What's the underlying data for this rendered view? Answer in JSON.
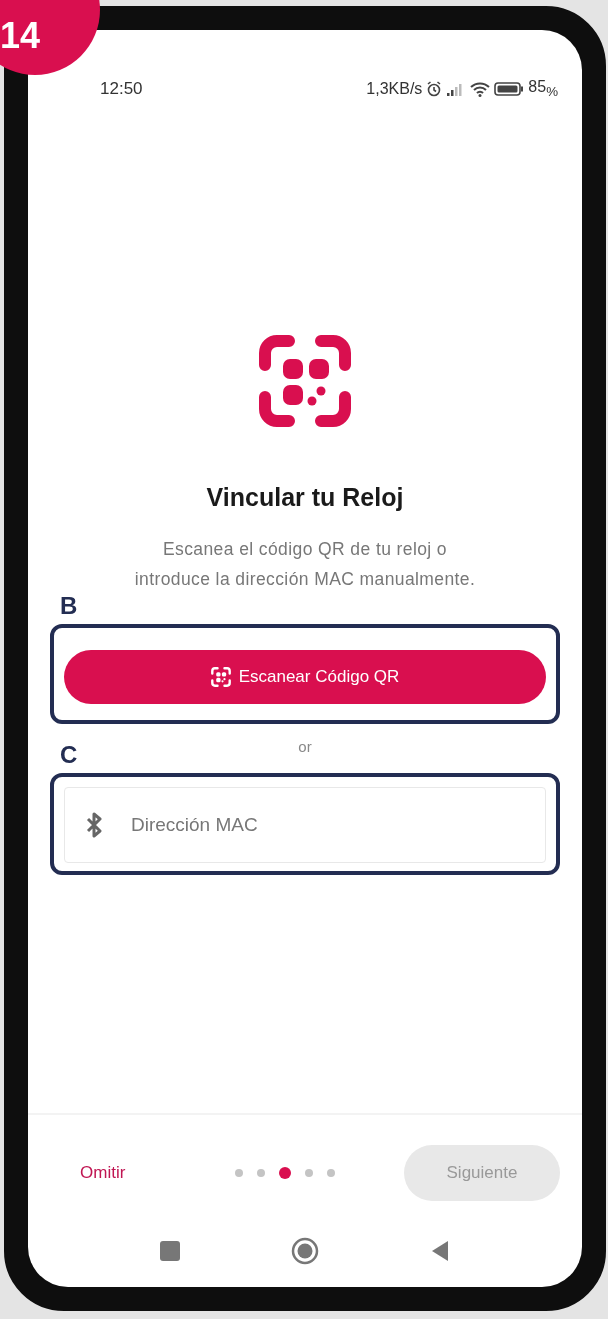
{
  "badge": "14",
  "status_bar": {
    "time": "12:50",
    "network_speed": "1,3KB/s",
    "battery": "85$_{%}$"
  },
  "title": "Vincular tu Reloj",
  "description": "Escanea el código QR de tu reloj o\nintroduce la dirección MAC manualmente.",
  "callouts": [
    {
      "label": "B"
    },
    {
      "label": "C"
    }
  ],
  "scan_button": {
    "label": "Escanear Código QR"
  },
  "separator": "or",
  "mac_field": {
    "placeholder": "Dirección MAC"
  },
  "footer": {
    "skip": "Omitir",
    "next": {
      "label": "Siguiente",
      "disabled": true
    },
    "pages": [
      {
        "selected": false
      },
      {
        "selected": false
      },
      {
        "selected": true
      },
      {
        "selected": false
      },
      {
        "selected": false
      }
    ]
  }
}
